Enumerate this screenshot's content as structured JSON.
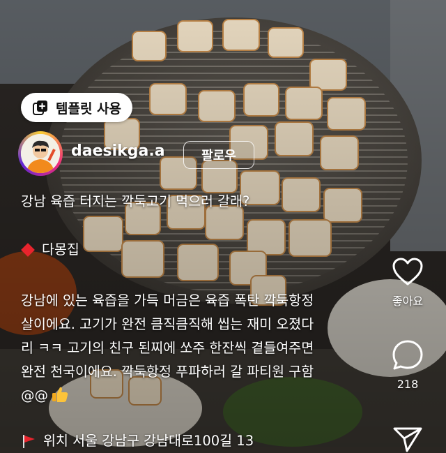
{
  "template_button": {
    "label": "템플릿 사용",
    "icon": "template-add-icon"
  },
  "author": {
    "username": "daesikga.a",
    "follow_label": "팔로우"
  },
  "caption": {
    "title": "강남 육즙 터지는 깍둑고기 먹으러 갈래?",
    "place": "다몽집",
    "body_lines": [
      "강남에 있는 육즙을 가득 머금은 육즙 폭탄 깍둑항정",
      "살이에요. 고기가 완전 큼직큼직해 씹는 재미 오졌다",
      "리 ㅋㅋ 고기의 친구 된찌에 쏘주 한잔씩 곁들여주면",
      "완전 천국이에요. 깍둑항정 푸파하러 갈 파티원 구함",
      "@@"
    ],
    "location": "위치  서울 강남구 강남대로100길 13"
  },
  "actions": {
    "like_label": "좋아요",
    "comment_count": "218"
  },
  "colors": {
    "accent_red": "#e8242d",
    "text": "#ffffff"
  }
}
